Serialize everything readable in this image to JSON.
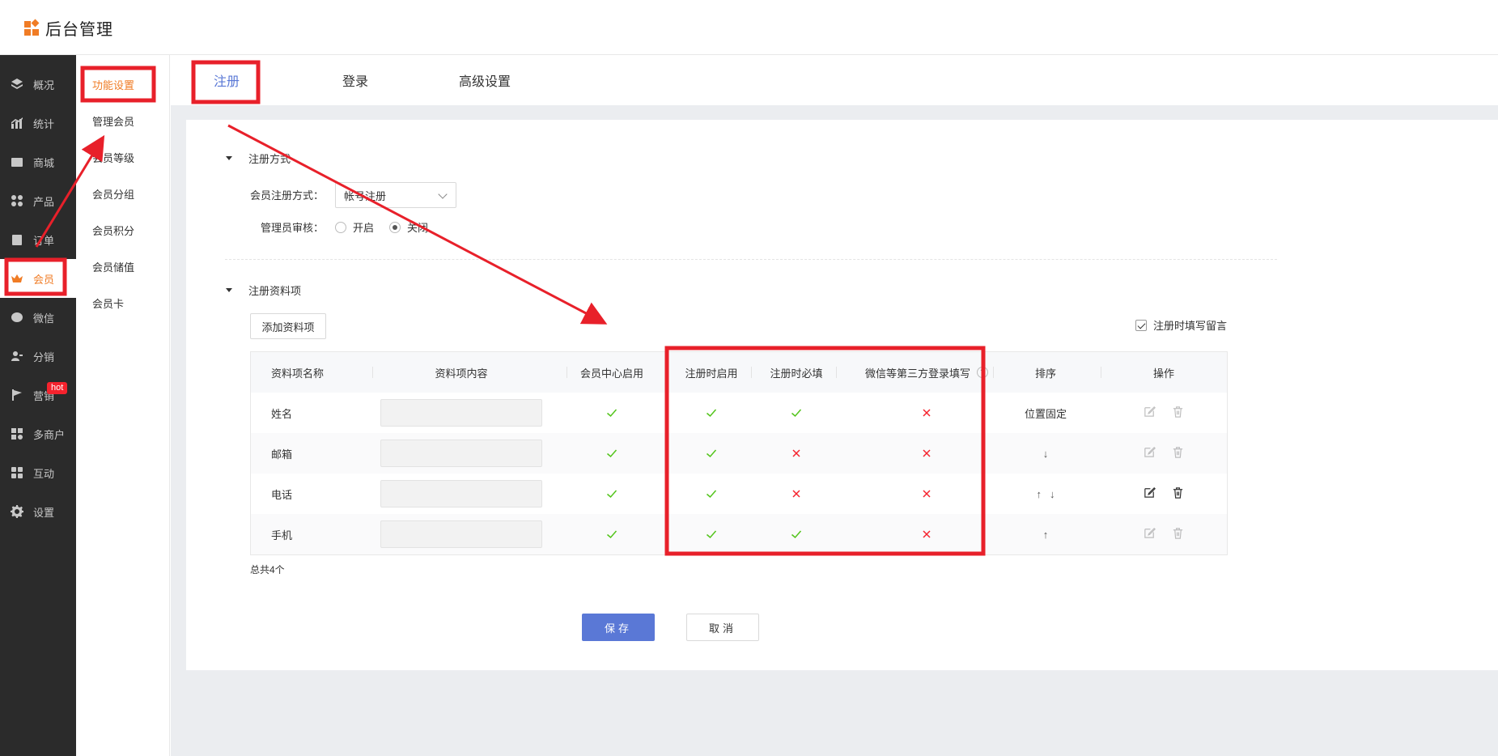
{
  "app": {
    "title": "后台管理"
  },
  "sidebar": {
    "items": [
      {
        "label": "概况",
        "icon": "layers-icon"
      },
      {
        "label": "统计",
        "icon": "chart-icon"
      },
      {
        "label": "商城",
        "icon": "shop-icon"
      },
      {
        "label": "产品",
        "icon": "grid-icon"
      },
      {
        "label": "订单",
        "icon": "order-icon"
      },
      {
        "label": "会员",
        "icon": "crown-icon",
        "active": true
      },
      {
        "label": "微信",
        "icon": "wechat-icon"
      },
      {
        "label": "分销",
        "icon": "user-share-icon"
      },
      {
        "label": "营销",
        "icon": "flag-icon",
        "badge": "hot"
      },
      {
        "label": "多商户",
        "icon": "multi-store-icon"
      },
      {
        "label": "互动",
        "icon": "interact-icon"
      },
      {
        "label": "设置",
        "icon": "gear-icon"
      }
    ]
  },
  "subnav": {
    "items": [
      {
        "label": "功能设置",
        "active": true
      },
      {
        "label": "管理会员"
      },
      {
        "label": "会员等级"
      },
      {
        "label": "会员分组"
      },
      {
        "label": "会员积分"
      },
      {
        "label": "会员储值"
      },
      {
        "label": "会员卡"
      }
    ]
  },
  "tabs": [
    {
      "label": "注册",
      "active": true
    },
    {
      "label": "登录"
    },
    {
      "label": "高级设置"
    }
  ],
  "register_method": {
    "section_title": "注册方式",
    "method_label": "会员注册方式：",
    "method_value": "帐号注册",
    "review_label": "管理员审核：",
    "review_options": [
      "开启",
      "关闭"
    ],
    "review_selected": "关闭"
  },
  "register_fields": {
    "section_title": "注册资料项",
    "add_button": "添加资料项",
    "leave_message_label": "注册时填写留言",
    "leave_message_checked": true,
    "columns": [
      "资料项名称",
      "资料项内容",
      "会员中心启用",
      "注册时启用",
      "注册时必填",
      "微信等第三方登录填写",
      "排序",
      "操作"
    ],
    "help_icon": "?",
    "rows": [
      {
        "name": "姓名",
        "member_center": true,
        "reg_enabled": true,
        "reg_required": true,
        "third_party": false,
        "sort_text": "位置固定",
        "sort_arrows": [],
        "ops_enabled": false
      },
      {
        "name": "邮箱",
        "member_center": true,
        "reg_enabled": true,
        "reg_required": false,
        "third_party": false,
        "sort_text": "",
        "sort_arrows": [
          "↓"
        ],
        "ops_enabled": false
      },
      {
        "name": "电话",
        "member_center": true,
        "reg_enabled": true,
        "reg_required": false,
        "third_party": false,
        "sort_text": "",
        "sort_arrows": [
          "↑",
          "↓"
        ],
        "ops_enabled": true
      },
      {
        "name": "手机",
        "member_center": true,
        "reg_enabled": true,
        "reg_required": true,
        "third_party": false,
        "sort_text": "",
        "sort_arrows": [
          "↑"
        ],
        "ops_enabled": false
      }
    ],
    "total": "总共4个"
  },
  "actions": {
    "save": "保存",
    "cancel": "取消"
  },
  "colors": {
    "accent": "#f07c25",
    "primary": "#5a78d6",
    "check": "#52c41a",
    "cross": "#f5222d",
    "annotation": "#e8202a"
  }
}
